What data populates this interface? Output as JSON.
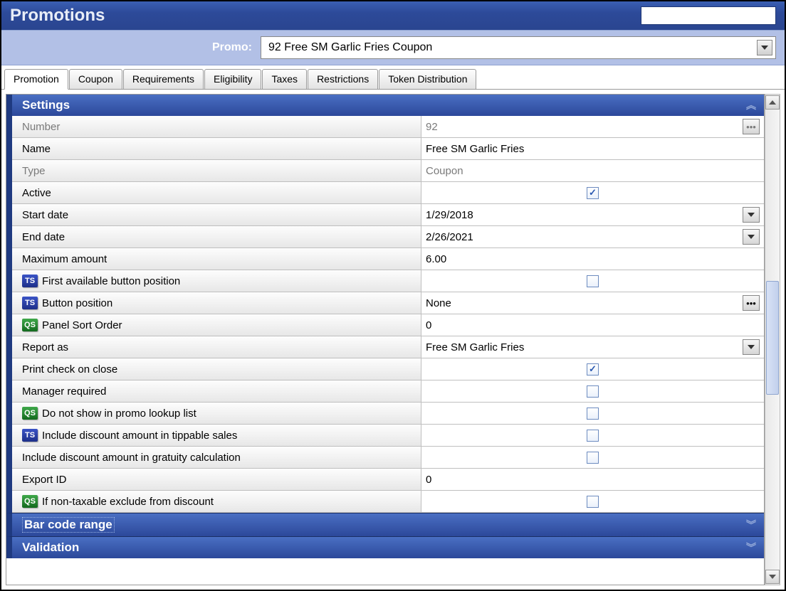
{
  "header": {
    "title": "Promotions"
  },
  "promo": {
    "label": "Promo:",
    "selected": "92 Free SM Garlic Fries Coupon"
  },
  "tabs": [
    {
      "label": "Promotion",
      "active": true
    },
    {
      "label": "Coupon",
      "active": false
    },
    {
      "label": "Requirements",
      "active": false
    },
    {
      "label": "Eligibility",
      "active": false
    },
    {
      "label": "Taxes",
      "active": false
    },
    {
      "label": "Restrictions",
      "active": false
    },
    {
      "label": "Token Distribution",
      "active": false
    }
  ],
  "sections": {
    "settings": {
      "title": "Settings"
    },
    "barcode": {
      "title": "Bar code range"
    },
    "validation": {
      "title": "Validation"
    }
  },
  "settings": {
    "number": {
      "label": "Number",
      "value": "92"
    },
    "name": {
      "label": "Name",
      "value": "Free SM Garlic Fries"
    },
    "type": {
      "label": "Type",
      "value": "Coupon"
    },
    "active": {
      "label": "Active",
      "checked": true
    },
    "start_date": {
      "label": "Start date",
      "value": "1/29/2018"
    },
    "end_date": {
      "label": "End date",
      "value": "2/26/2021"
    },
    "max_amount": {
      "label": "Maximum amount",
      "value": "6.00"
    },
    "first_btn": {
      "label": "First available button position",
      "checked": false,
      "badge": "TS"
    },
    "btn_pos": {
      "label": "Button position",
      "value": "None",
      "badge": "TS"
    },
    "panel_sort": {
      "label": "Panel Sort Order",
      "value": "0",
      "badge": "QS"
    },
    "report_as": {
      "label": "Report as",
      "value": "Free SM Garlic Fries"
    },
    "print_check": {
      "label": "Print check on close",
      "checked": true
    },
    "mgr_req": {
      "label": "Manager required",
      "checked": false
    },
    "no_lookup": {
      "label": "Do not show in promo lookup list",
      "checked": false,
      "badge": "QS"
    },
    "tippable": {
      "label": "Include discount amount in tippable sales",
      "checked": false,
      "badge": "TS"
    },
    "gratuity": {
      "label": "Include discount amount in gratuity calculation",
      "checked": false
    },
    "export_id": {
      "label": "Export ID",
      "value": "0"
    },
    "nontax": {
      "label": "If non-taxable exclude from discount",
      "checked": false,
      "badge": "QS"
    }
  }
}
